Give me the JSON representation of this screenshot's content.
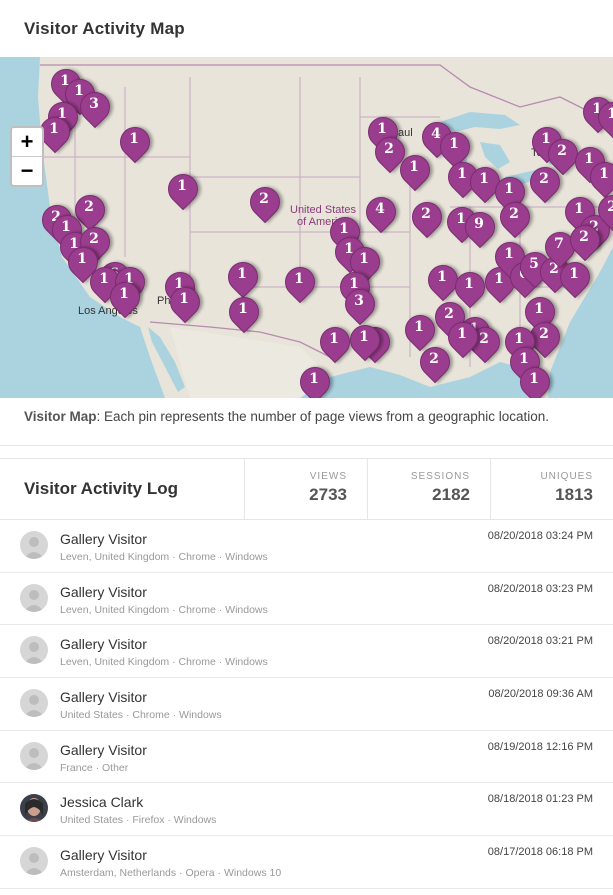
{
  "map_panel": {
    "title": "Visitor Activity Map",
    "zoom_in": "+",
    "zoom_out": "−",
    "labels": {
      "us_line1": "United States",
      "us_line2": "of America",
      "la": "Los Angeles",
      "phoenix": "Pho",
      "toronto": "To",
      "stpaul": "aul"
    },
    "caption_label": "Visitor Map",
    "caption_text": ": Each pin represents the number of page views from a geographic location.",
    "pin_color": "#9b3d8e",
    "pins": [
      "1",
      "1",
      "1",
      "3",
      "1",
      "1",
      "1",
      "2",
      "2",
      "1",
      "1",
      "2",
      "1",
      "6",
      "1",
      "1",
      "1",
      "1",
      "1",
      "1",
      "1",
      "1",
      "2",
      "1",
      "4",
      "1",
      "1",
      "1",
      "3",
      "1",
      "2",
      "1",
      "2",
      "1",
      "9",
      "4",
      "1",
      "1",
      "1",
      "1",
      "2",
      "1",
      "1",
      "1",
      "1",
      "6",
      "5",
      "2",
      "7",
      "1",
      "2",
      "1",
      "1",
      "1",
      "2",
      "1",
      "2",
      "1",
      "2",
      "1",
      "1",
      "1",
      "1",
      "1",
      "1",
      "2",
      "1",
      "1",
      "1",
      "1",
      "2",
      "1",
      "2",
      "2",
      "1",
      "2"
    ]
  },
  "activity_log": {
    "title": "Visitor Activity Log",
    "stats": [
      {
        "label": "VIEWS",
        "value": "2733"
      },
      {
        "label": "SESSIONS",
        "value": "2182"
      },
      {
        "label": "UNIQUES",
        "value": "1813"
      }
    ],
    "rows": [
      {
        "name": "Gallery Visitor",
        "meta": "Leven, United Kingdom · Chrome · Windows",
        "time": "08/20/2018 03:24 PM"
      },
      {
        "name": "Gallery Visitor",
        "meta": "Leven, United Kingdom · Chrome · Windows",
        "time": "08/20/2018 03:23 PM"
      },
      {
        "name": "Gallery Visitor",
        "meta": "Leven, United Kingdom · Chrome · Windows",
        "time": "08/20/2018 03:21 PM"
      },
      {
        "name": "Gallery Visitor",
        "meta": "United States · Chrome · Windows",
        "time": "08/20/2018 09:36 AM"
      },
      {
        "name": "Gallery Visitor",
        "meta": "France · Other",
        "time": "08/19/2018 12:16 PM"
      },
      {
        "name": "Jessica Clark",
        "meta": "United States · Firefox · Windows",
        "time": "08/18/2018 01:23 PM"
      },
      {
        "name": "Gallery Visitor",
        "meta": "Amsterdam, Netherlands · Opera · Windows 10",
        "time": "08/17/2018 06:18 PM"
      }
    ]
  }
}
